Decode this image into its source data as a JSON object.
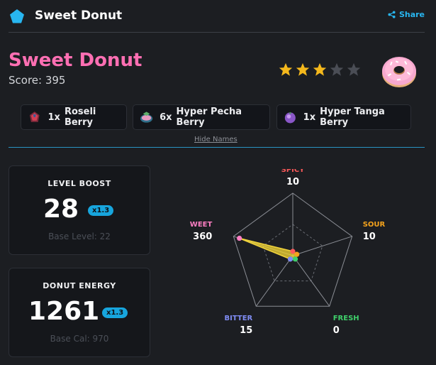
{
  "header": {
    "app_title": "Sweet Donut",
    "share_label": "Share",
    "brand_color": "#28b6f0"
  },
  "main": {
    "title": "Sweet Donut",
    "score_text": "Score: 395",
    "rating": {
      "value": 3,
      "max": 5
    },
    "title_color": "#ff6fb3"
  },
  "berries": [
    {
      "qty": "1x",
      "name": "Roseli Berry",
      "icon": "roseli-berry-icon"
    },
    {
      "qty": "6x",
      "name": "Hyper Pecha Berry",
      "icon": "hyper-pecha-berry-icon"
    },
    {
      "qty": "1x",
      "name": "Hyper Tanga Berry",
      "icon": "hyper-tanga-berry-icon"
    }
  ],
  "hide_names_label": "Hide Names",
  "level_boost": {
    "label": "LEVEL BOOST",
    "value": "28",
    "multiplier": "x1.3",
    "base": "Base Level: 22"
  },
  "donut_energy": {
    "label": "DONUT ENERGY",
    "value": "1261",
    "multiplier": "x1.3",
    "base": "Base Cal: 970"
  },
  "flavors": [
    {
      "name": "SPICY",
      "value": "10",
      "color": "#ff5a5a"
    },
    {
      "name": "SOUR",
      "value": "10",
      "color": "#f4a31c"
    },
    {
      "name": "FRESH",
      "value": "0",
      "color": "#3fcf6a"
    },
    {
      "name": "BITTER",
      "value": "15",
      "color": "#7f8cf3"
    },
    {
      "name": "SWEET",
      "value": "360",
      "color": "#ff7fc4"
    }
  ]
}
